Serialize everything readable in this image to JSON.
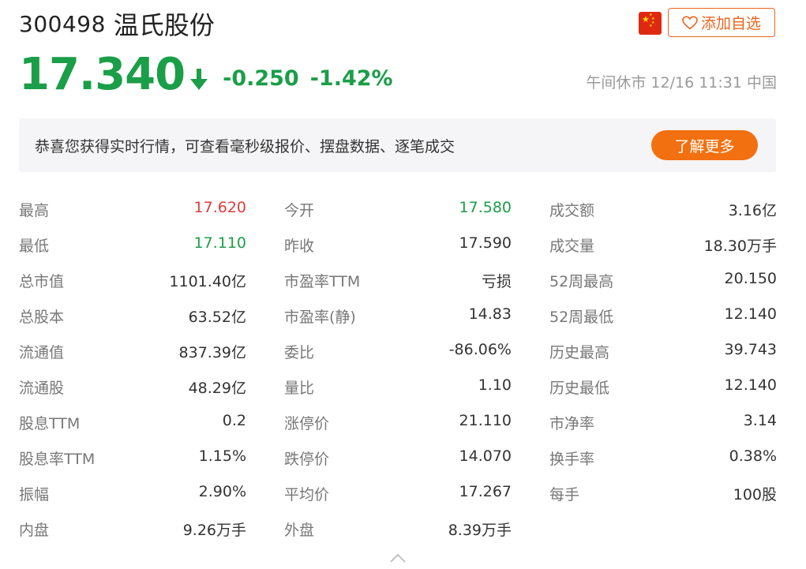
{
  "stock": {
    "code": "300498",
    "name": "温氏股份",
    "price": "17.340",
    "change": "-0.250",
    "change_pct": "-1.42%",
    "status": "午间休市 12/16 11:31 中国"
  },
  "favorite_button": {
    "label": "添加自选"
  },
  "banner": {
    "text": "恭喜您获得实时行情，可查看毫秒级报价、摆盘数据、逐笔成交",
    "button_label": "了解更多"
  },
  "stats": [
    [
      {
        "label": "最高",
        "value": "17.620",
        "tone": "up"
      },
      {
        "label": "今开",
        "value": "17.580",
        "tone": "down"
      },
      {
        "label": "成交额",
        "value": "3.16亿"
      }
    ],
    [
      {
        "label": "最低",
        "value": "17.110",
        "tone": "down"
      },
      {
        "label": "昨收",
        "value": "17.590"
      },
      {
        "label": "成交量",
        "value": "18.30万手"
      }
    ],
    [
      {
        "label": "总市值",
        "value": "1101.40亿"
      },
      {
        "label": "市盈率TTM",
        "value": "亏损"
      },
      {
        "label": "52周最高",
        "value": "20.150"
      }
    ],
    [
      {
        "label": "总股本",
        "value": "63.52亿"
      },
      {
        "label": "市盈率(静)",
        "value": "14.83"
      },
      {
        "label": "52周最低",
        "value": "12.140"
      }
    ],
    [
      {
        "label": "流通值",
        "value": "837.39亿"
      },
      {
        "label": "委比",
        "value": "-86.06%"
      },
      {
        "label": "历史最高",
        "value": "39.743"
      }
    ],
    [
      {
        "label": "流通股",
        "value": "48.29亿"
      },
      {
        "label": "量比",
        "value": "1.10"
      },
      {
        "label": "历史最低",
        "value": "12.140"
      }
    ],
    [
      {
        "label": "股息TTM",
        "value": "0.2"
      },
      {
        "label": "涨停价",
        "value": "21.110"
      },
      {
        "label": "市净率",
        "value": "3.14"
      }
    ],
    [
      {
        "label": "股息率TTM",
        "value": "1.15%"
      },
      {
        "label": "跌停价",
        "value": "14.070"
      },
      {
        "label": "换手率",
        "value": "0.38%"
      }
    ],
    [
      {
        "label": "振幅",
        "value": "2.90%"
      },
      {
        "label": "平均价",
        "value": "17.267"
      },
      {
        "label": "每手",
        "value": "100股"
      }
    ],
    [
      {
        "label": "内盘",
        "value": "9.26万手"
      },
      {
        "label": "外盘",
        "value": "8.39万手"
      }
    ]
  ],
  "colors": {
    "up": "#e03c3c",
    "down": "#1b9e48",
    "accent": "#f2700f"
  },
  "icons": {
    "flag": "china-flag-icon",
    "favorite": "heart-icon",
    "price_direction": "arrow-down-icon",
    "expand": "chevron-up-icon"
  }
}
